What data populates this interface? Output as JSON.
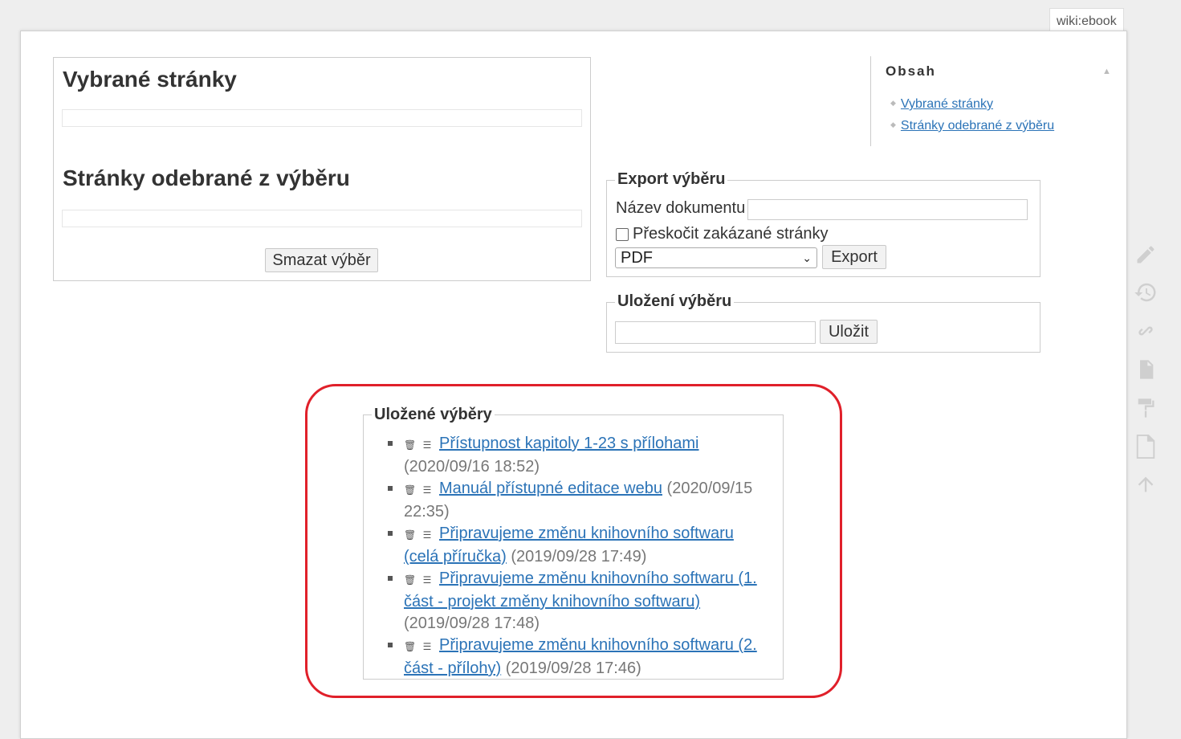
{
  "page_id": "wiki:ebook",
  "selected_pages": {
    "heading": "Vybrané stránky",
    "removed_heading": "Stránky odebrané z výběru",
    "clear_button": "Smazat výběr"
  },
  "toc": {
    "title": "Obsah",
    "toggle": "▲",
    "items": [
      "Vybrané stránky",
      "Stránky odebrané z výběru"
    ]
  },
  "export": {
    "legend": "Export výběru",
    "name_label": "Název dokumentu",
    "name_value": "",
    "skip_label": "Přeskočit zakázané stránky",
    "skip_checked": false,
    "format_selected": "PDF",
    "export_button": "Export"
  },
  "save": {
    "legend": "Uložení výběru",
    "name_value": "",
    "save_button": "Uložit"
  },
  "saved_selections": {
    "legend": "Uložené výběry",
    "items": [
      {
        "title": "Přístupnost kapitoly 1-23 s přílohami",
        "date": "(2020/09/16 18:52)"
      },
      {
        "title": "Manuál přístupné editace webu",
        "date": "(2020/09/15 22:35)"
      },
      {
        "title": "Připravujeme změnu knihovního softwaru (celá příručka)",
        "date": "(2019/09/28 17:49)"
      },
      {
        "title": "Připravujeme změnu knihovního softwaru (1. část - projekt změny knihovního softwaru)",
        "date": "(2019/09/28 17:48)"
      },
      {
        "title": "Připravujeme změnu knihovního softwaru (2. část - přílohy)",
        "date": "(2019/09/28 17:46)"
      }
    ]
  },
  "tools": [
    "pencil-icon",
    "history-icon",
    "link-icon",
    "pdf-icon",
    "paint-roller-icon",
    "new-page-icon",
    "arrow-up-icon"
  ],
  "colors": {
    "link": "#2b73b7",
    "highlight": "#e0202a"
  }
}
